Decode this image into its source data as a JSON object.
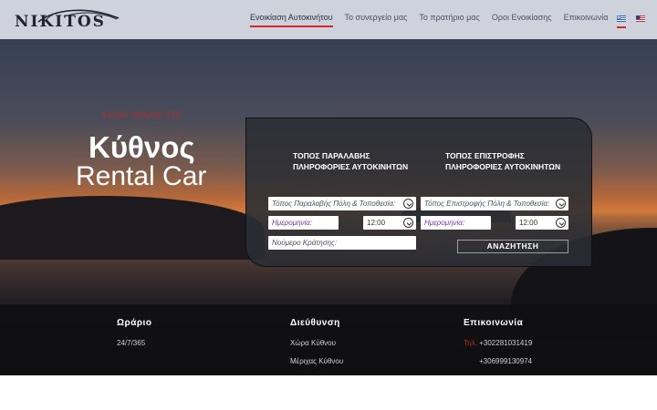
{
  "header": {
    "logo_text": "NIKITOS",
    "nav": [
      "Ενοικίαση Αυτοκινήτου",
      "Το συνεργείο μας",
      "Το πρατήριο μας",
      "Οροι Ενοικίασης",
      "Επικοινωνία"
    ],
    "active_nav": "Ενοικίαση Αυτοκινήτου",
    "languages": [
      "greek-flag-icon",
      "us-flag-icon"
    ]
  },
  "hero": {
    "welcome": "ΚΑΛΩΣ ΗΛΘΑΤΕ ΣΤΟ",
    "title": "Κύθνος",
    "subtitle": "Rental Car"
  },
  "booking": {
    "pickup_header_line1": "ΤΟΠΟΣ ΠΑΡΑΛΑΒΗΣ",
    "pickup_header_line2": "ΠΛΗΡΟΦΟΡΙΕΣ ΑΥΤΟΚΙΝΗΤΩΝ",
    "return_header_line1": "ΤΟΠΟΣ ΕΠΙΣΤΡΟΦΗΣ",
    "return_header_line2": "ΠΛΗΡΟΦΟΡΙΕΣ ΑΥΤΟΚΙΝΗΤΩΝ",
    "pickup_location_placeholder": "Τόπος Παραλαβής Πόλη & Τοποθεσία:",
    "return_location_placeholder": "Τόπος Επιστροφής Πόλη & Τοποθεσία:",
    "pickup_date_placeholder": "Ημερομηνία:",
    "return_date_placeholder": "Ημερομηνία:",
    "pickup_time": "12:00",
    "return_time": "12:00",
    "booking_number_placeholder": "Νούμερο Κράτησης:",
    "search_label": "ΑΝΑΖΗΤΗΣΗ"
  },
  "footer": {
    "hours_title": "Ωράριο",
    "hours_value": "24/7/365",
    "address_title": "Διεύθυνση",
    "address_line1": "Χώρα Κύθνου",
    "address_line2": "Μέριχας Κύθνου",
    "contact_title": "Επικοινωνία",
    "phone_label": "Τηλ.",
    "phone1": "+302281031419",
    "phone2": "+306999130974"
  },
  "colors": {
    "accent_red": "#d42a2a",
    "header_bg": "#dce0e8",
    "panel_bg": "#2a2d34",
    "date_placeholder": "#7a3aa0"
  }
}
